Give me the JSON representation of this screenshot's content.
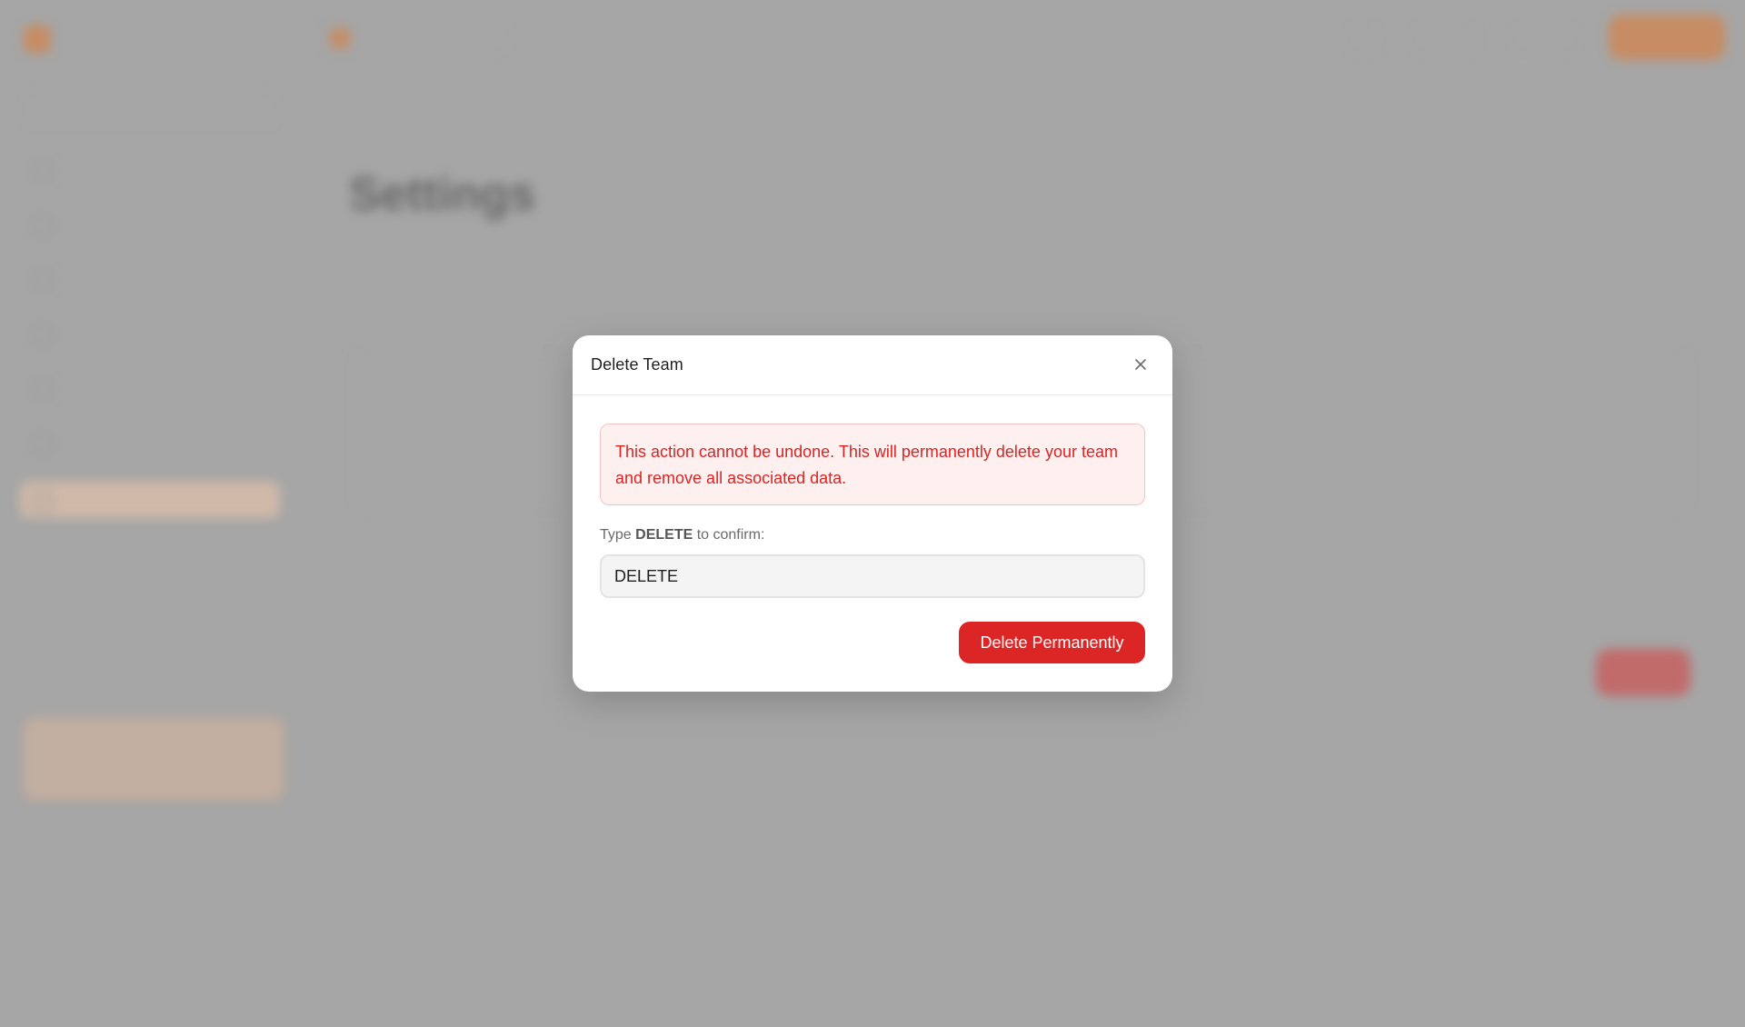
{
  "modal": {
    "title": "Delete Team",
    "close_icon": "close-icon",
    "warning": "This action cannot be undone. This will permanently delete your team and remove all associated data.",
    "confirm_prefix": "Type ",
    "confirm_keyword": "DELETE",
    "confirm_suffix": " to confirm:",
    "input_value": "DELETE",
    "delete_button": "Delete Permanently"
  },
  "background": {
    "page_title": "Settings"
  },
  "colors": {
    "danger": "#dc2626",
    "danger_bg": "#fff0f0",
    "accent": "#e2772d"
  }
}
